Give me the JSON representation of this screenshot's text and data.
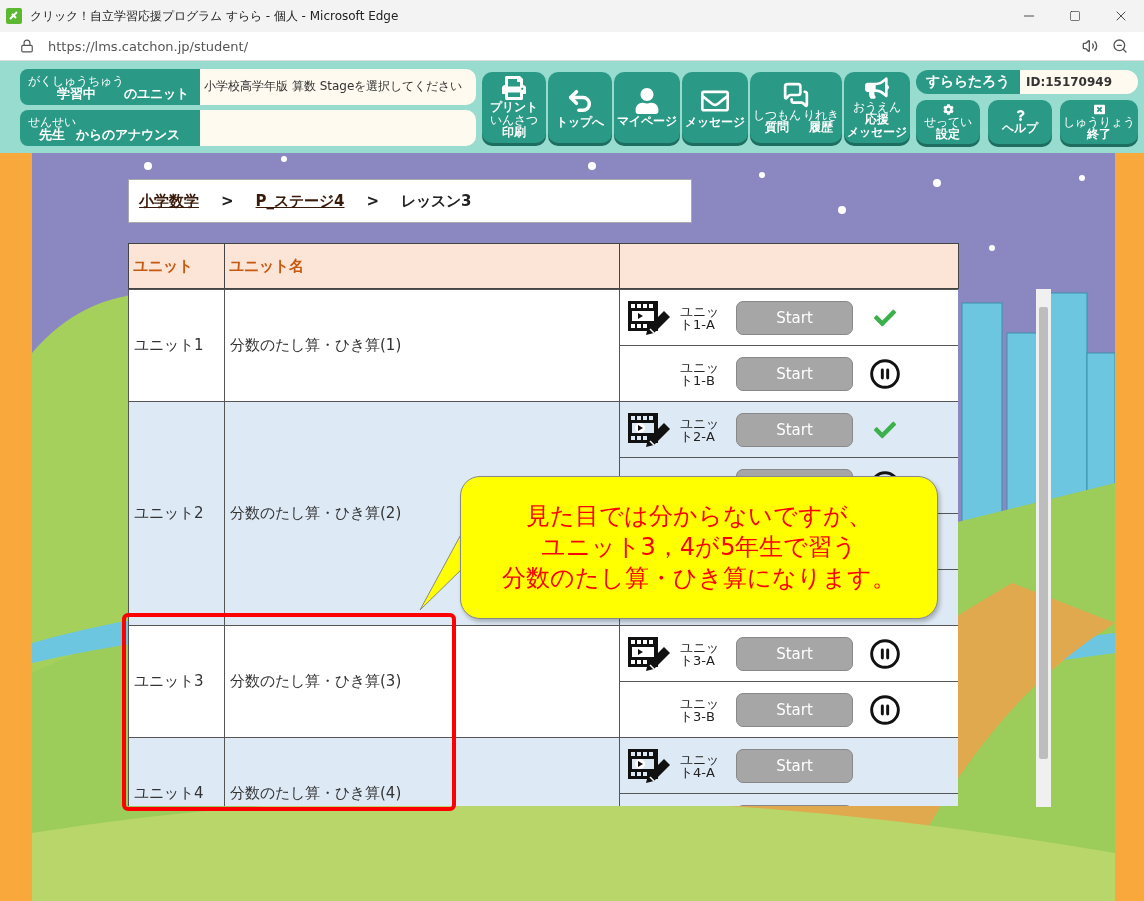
{
  "window": {
    "title": "クリック！自立学習応援プログラム すらら - 個人 - Microsoft Edge"
  },
  "address_bar": {
    "url": "https://lms.catchon.jp/student/"
  },
  "header": {
    "status_rows": [
      {
        "label": [
          {
            "text": "学習中",
            "ruby": "がくしゅうちゅう"
          },
          {
            "text": "のユニット"
          }
        ],
        "value": "小学校高学年版 算数 Stageを選択してください"
      },
      {
        "label": [
          {
            "text": "先生",
            "ruby": "せんせい"
          },
          {
            "text": "からのアナウンス"
          }
        ],
        "value": ""
      }
    ],
    "nav_buttons": [
      {
        "lines": [
          [
            {
              "text": "プリント"
            }
          ],
          [
            {
              "text": "印刷",
              "ruby": "いんさつ"
            }
          ]
        ]
      },
      {
        "lines": [
          [
            {
              "text": "トップへ"
            }
          ]
        ]
      },
      {
        "lines": [
          [
            {
              "text": "マイページ"
            }
          ]
        ]
      },
      {
        "lines": [
          [
            {
              "text": "メッセージ"
            }
          ]
        ]
      },
      {
        "lines": [
          [
            {
              "text": "質問",
              "ruby": "しつもん"
            },
            {
              "text": "履歴",
              "ruby": "りれき"
            }
          ]
        ]
      },
      {
        "lines": [
          [
            {
              "text": "応援",
              "ruby": "おうえん"
            }
          ],
          [
            {
              "text": "メッセージ"
            }
          ]
        ]
      }
    ],
    "user": {
      "name": "すららたろう",
      "id": "ID:15170949"
    },
    "system_buttons": [
      {
        "lines": [
          [
            {
              "text": "設定",
              "ruby": "せってい"
            }
          ]
        ]
      },
      {
        "lines": [
          [
            {
              "text": "ヘルプ"
            }
          ]
        ]
      },
      {
        "lines": [
          [
            {
              "text": "終了",
              "ruby": "しゅうりょう"
            }
          ]
        ]
      }
    ]
  },
  "breadcrumb": [
    {
      "kind": "link",
      "text": "小学数学"
    },
    {
      "kind": "separator",
      "text": ">"
    },
    {
      "kind": "link",
      "text": "P_ステージ4"
    },
    {
      "kind": "separator",
      "text": ">"
    },
    {
      "kind": "current",
      "text": "レッスン3"
    }
  ],
  "table": {
    "columns": [
      "ユニット",
      "ユニット名"
    ],
    "units": [
      {
        "unit": "ユニット1",
        "name": "分数のたし算・ひき算(1)",
        "lessons": [
          {
            "kind": "lesson",
            "video": true,
            "label": "ユニット1-A",
            "button": "Start",
            "completed": true,
            "paused": false
          },
          {
            "kind": "lesson",
            "video": false,
            "label": "ユニット1-B",
            "button": "Start",
            "completed": false,
            "paused": true
          }
        ]
      },
      {
        "unit": "ユニット2",
        "name": "分数のたし算・ひき算(2)",
        "lessons": [
          {
            "kind": "lesson",
            "video": true,
            "label": "ユニット2-A",
            "button": "Start",
            "completed": true,
            "paused": false
          },
          {
            "kind": "covered",
            "paused": true
          },
          {
            "kind": "covered"
          },
          {
            "kind": "covered"
          }
        ]
      },
      {
        "unit": "ユニット3",
        "name": "分数のたし算・ひき算(3)",
        "lessons": [
          {
            "kind": "lesson",
            "video": true,
            "label": "ユニット3-A",
            "button": "Start",
            "completed": false,
            "paused": true
          },
          {
            "kind": "lesson",
            "video": false,
            "label": "ユニット3-B",
            "button": "Start",
            "completed": false,
            "paused": true
          }
        ]
      },
      {
        "unit": "ユニット4",
        "name": "分数のたし算・ひき算(4)",
        "lessons": [
          {
            "kind": "lesson",
            "video": true,
            "label": "ユニット4-A",
            "button": "Start",
            "completed": false,
            "paused": false
          },
          {
            "kind": "covered"
          }
        ]
      }
    ]
  },
  "callout": {
    "lines": [
      "見た目では分からないですが、",
      "ユニット3，4が5年生で習う",
      "分数のたし算・ひき算になります。"
    ]
  }
}
